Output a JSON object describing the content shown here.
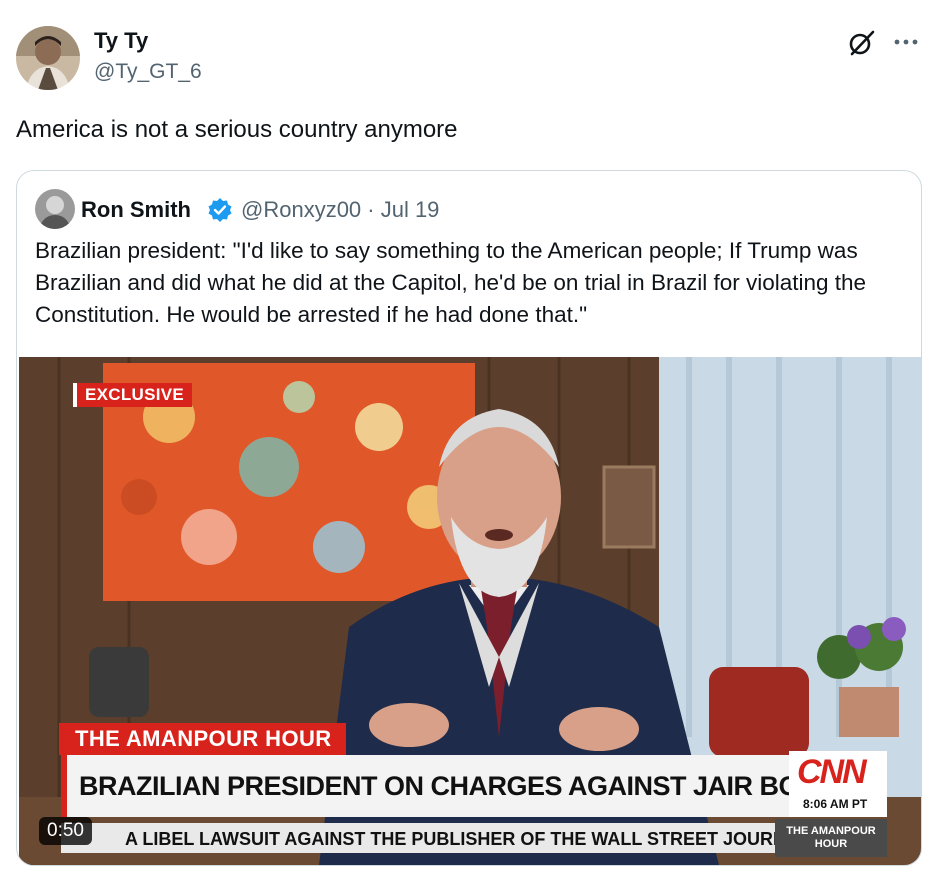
{
  "tweet": {
    "author_name": "Ty Ty",
    "author_handle": "@Ty_GT_6",
    "text": "America is not a serious country anymore"
  },
  "quoted_tweet": {
    "author_name": "Ron Smith",
    "handle_date": "@Ronxyz00 · Jul 19",
    "text": "Brazilian president: \"I'd like to say something to the American people; If Trump was Brazilian and did what he did at the Capitol, he'd be on trial in Brazil for violating the Constitution. He would be arrested if he had done that.\"",
    "video": {
      "duration": "0:50",
      "exclusive_label": "EXCLUSIVE",
      "show_name": "THE AMANPOUR HOUR",
      "headline": "BRAZILIAN PRESIDENT ON CHARGES AGAINST JAIR BOLSONARO",
      "network": "CNN",
      "time": "8:06 AM PT",
      "ticker": "A LIBEL LAWSUIT AGAINST THE PUBLISHER OF THE WALL STREET JOURNAL AND",
      "ticker_tag": "THE AMANPOUR HOUR"
    }
  },
  "icons": [
    "grok-icon",
    "more-icon",
    "verified-icon"
  ],
  "colors": {
    "accent": "#1d9bf0",
    "text": "#0f1419",
    "secondary": "#536471",
    "cnn_red": "#d8231c"
  }
}
